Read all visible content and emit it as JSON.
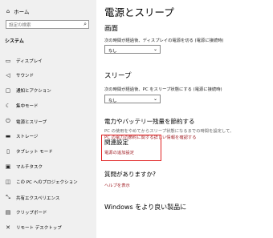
{
  "sidebar": {
    "home_label": "ホーム",
    "search_placeholder": "設定の検索",
    "section": "システム",
    "items": [
      {
        "label": "ディスプレイ",
        "icon": "monitor-icon"
      },
      {
        "label": "サウンド",
        "icon": "speaker-icon"
      },
      {
        "label": "通知とアクション",
        "icon": "notification-icon"
      },
      {
        "label": "集中モード",
        "icon": "moon-icon"
      },
      {
        "label": "電源とスリープ",
        "icon": "power-icon"
      },
      {
        "label": "ストレージ",
        "icon": "storage-icon"
      },
      {
        "label": "タブレット モード",
        "icon": "tablet-icon"
      },
      {
        "label": "マルチタスク",
        "icon": "multitask-icon"
      },
      {
        "label": "この PC へのプロジェクション",
        "icon": "projection-icon"
      },
      {
        "label": "共有エクスペリエンス",
        "icon": "share-icon"
      },
      {
        "label": "クリップボード",
        "icon": "clipboard-icon"
      },
      {
        "label": "リモート デスクトップ",
        "icon": "remote-desktop-icon"
      }
    ]
  },
  "main": {
    "title": "電源とスリープ",
    "screen": {
      "heading": "画面",
      "desc": "次の時間が経過後、ディスプレイの電源を切る (電源に接続時)",
      "value": "なし"
    },
    "sleep": {
      "heading": "スリープ",
      "desc": "次の時間が経過後、PC をスリープ状態にする (電源に接続時)",
      "value": "なし"
    },
    "save": {
      "heading": "電力やバッテリー残量を節約する",
      "line1": "PC の使用をやめてからスリープ状態になるまでの時間を設定して、",
      "line2": "PC の電力の節約に関する詳しい情報を確認する"
    },
    "related": {
      "heading": "関連設定",
      "link": "電源の追加設定"
    },
    "question": {
      "heading": "質問がありますか?",
      "link": "ヘルプを表示"
    },
    "improve": {
      "heading": "Windows をより良い製品に"
    }
  }
}
